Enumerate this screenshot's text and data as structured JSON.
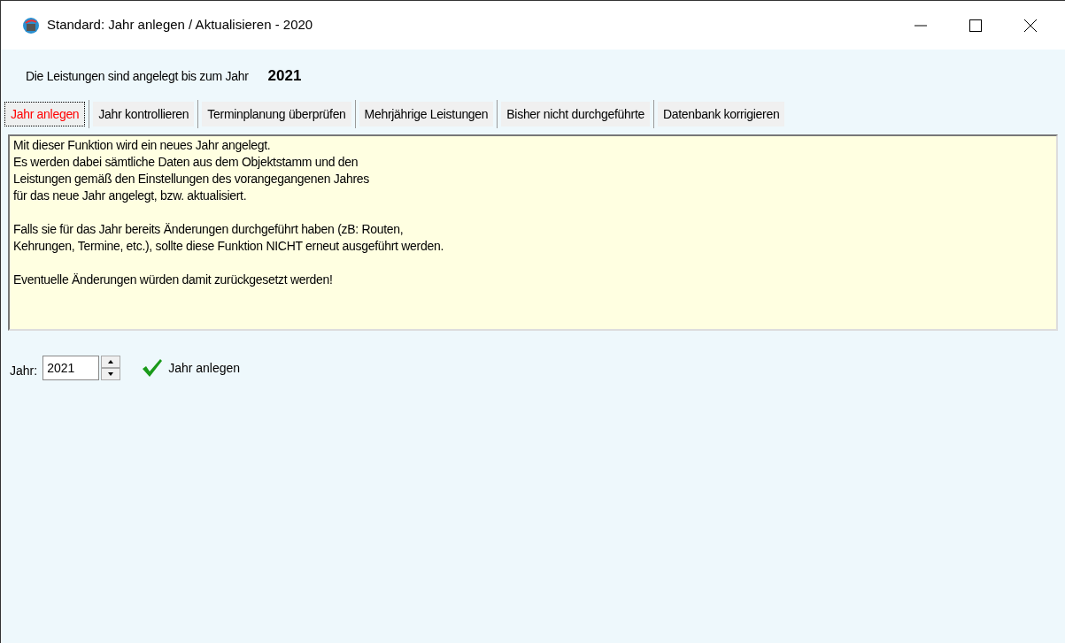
{
  "window": {
    "title": "Standard: Jahr anlegen / Aktualisieren - 2020"
  },
  "status": {
    "label": "Die Leistungen sind angelegt bis zum Jahr",
    "year": "2021"
  },
  "tabs": [
    {
      "label": "Jahr anlegen",
      "selected": true
    },
    {
      "label": "Jahr kontrollieren",
      "selected": false
    },
    {
      "label": "Terminplanung überprüfen",
      "selected": false
    },
    {
      "label": "Mehrjährige Leistungen",
      "selected": false
    },
    {
      "label": "Bisher nicht durchgeführte",
      "selected": false
    },
    {
      "label": "Datenbank korrigieren",
      "selected": false
    }
  ],
  "description": [
    [
      "Mit dieser Funktion wird ein neues Jahr angelegt.",
      "Es werden dabei sämtliche Daten aus dem Objektstamm und den",
      "Leistungen gemäß den Einstellungen des vorangegangenen Jahres",
      "für das neue Jahr angelegt, bzw. aktualisiert."
    ],
    [
      "Falls sie für das Jahr bereits Änderungen durchgeführt haben (zB: Routen,",
      "Kehrungen, Termine, etc.),  sollte diese Funktion NICHT erneut ausgeführt werden."
    ],
    [
      "Eventuelle Änderungen würden damit zurückgesetzt werden!"
    ]
  ],
  "year_field": {
    "label": "Jahr:",
    "value": "2021"
  },
  "create_button": {
    "label": "Jahr anlegen"
  }
}
